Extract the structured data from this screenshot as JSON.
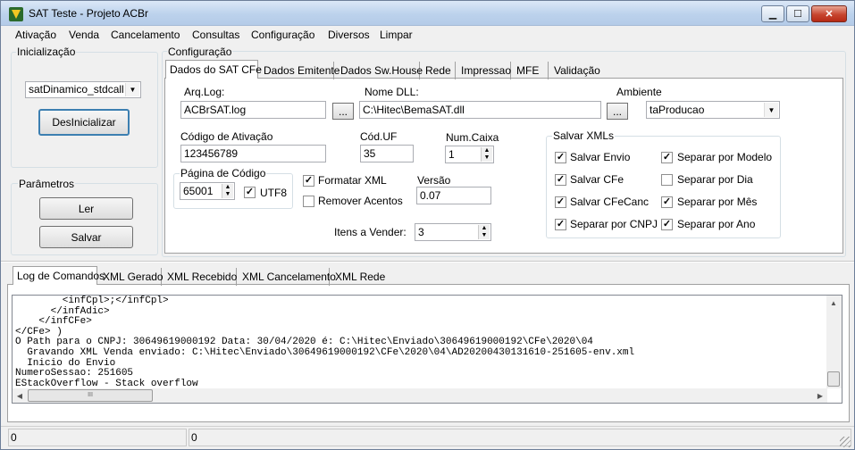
{
  "window": {
    "title": "SAT Teste - Projeto ACBr",
    "minimize": "▁",
    "maximize": "☐",
    "close": "✕"
  },
  "menu": [
    "Ativação",
    "Venda",
    "Cancelamento",
    "Consultas",
    "Configuração",
    "Diversos",
    "Limpar"
  ],
  "init": {
    "group": "Inicialização",
    "lib_value": "satDinamico_stdcall",
    "button": "DesInicializar"
  },
  "params": {
    "group": "Parâmetros",
    "read": "Ler",
    "save": "Salvar"
  },
  "config": {
    "group": "Configuração",
    "tabs": [
      "Dados do SAT CFe",
      "Dados Emitente",
      "Dados Sw.House",
      "Rede",
      "Impressao",
      "MFE",
      "Validação"
    ],
    "arq_log_label": "Arq.Log:",
    "arq_log": "ACBrSAT.log",
    "browse": "...",
    "dll_label": "Nome DLL:",
    "dll": "C:\\Hitec\\BemaSAT.dll",
    "ambiente_label": "Ambiente",
    "ambiente": "taProducao",
    "cod_ativ_label": "Código de Ativação",
    "cod_ativ": "123456789",
    "cod_uf_label": "Cód.UF",
    "cod_uf": "35",
    "num_caixa_label": "Num.Caixa",
    "num_caixa": "1",
    "pagina_label": "Página de Código",
    "pagina": "65001",
    "utf8": "UTF8",
    "formatar_xml": "Formatar XML",
    "remover_acentos": "Remover Acentos",
    "versao_label": "Versão",
    "versao": "0.07",
    "itens_label": "Itens a Vender:",
    "itens": "3",
    "salvar_group": "Salvar XMLs",
    "salvar_envio": "Salvar Envio",
    "salvar_cfe": "Salvar CFe",
    "salvar_cfecanc": "Salvar CFeCanc",
    "sep_cnpj": "Separar por CNPJ",
    "sep_modelo": "Separar por Modelo",
    "sep_dia": "Separar por Dia",
    "sep_mes": "Separar por Mês",
    "sep_ano": "Separar por Ano",
    "check_mark": "✓",
    "spin_up": "▲",
    "spin_down": "▼"
  },
  "bottom_tabs": [
    "Log de Comandos",
    "XML Gerado",
    "XML Recebido",
    "XML Cancelamento",
    "XML Rede"
  ],
  "log": [
    "        <infCpl>;</infCpl>",
    "      </infAdic>",
    "    </infCFe>",
    "</CFe> )",
    "O Path para o CNPJ: 30649619000192 Data: 30/04/2020 é: C:\\Hitec\\Enviado\\30649619000192\\CFe\\2020\\04",
    "  Gravando XML Venda enviado: C:\\Hitec\\Enviado\\30649619000192\\CFe\\2020\\04\\AD20200430131610-251605-env.xml",
    "  Inicio do Envio",
    "NumeroSessao: 251605",
    "EStackOverflow - Stack overflow"
  ],
  "scroll": {
    "up": "▲",
    "down": "▼",
    "left": "◀",
    "right": "▶",
    "grip": "III"
  },
  "status": {
    "left": "0",
    "right": "0"
  }
}
